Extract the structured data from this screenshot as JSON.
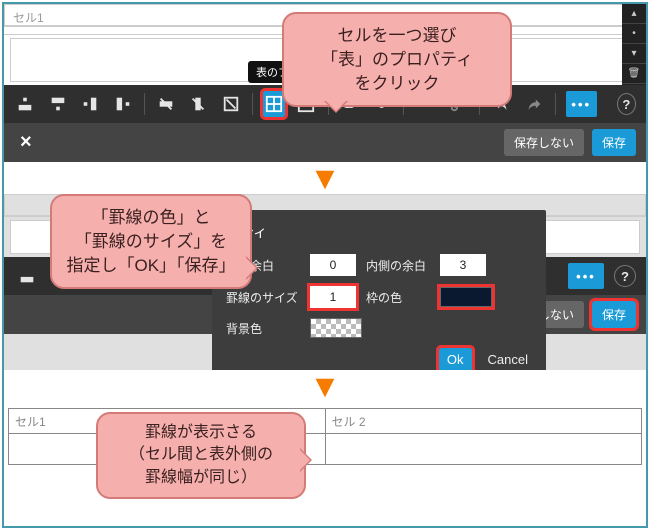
{
  "section1": {
    "cell1_label": "セル1",
    "tooltip": "表のプロパティ",
    "footer": {
      "cancel": "保存しない",
      "save": "保存"
    }
  },
  "callouts": {
    "c1_l1": "セルを一つ選び",
    "c1_l2": "「表」のプロパティ",
    "c1_l3": "をクリック",
    "c2_l1": "「罫線の色」と",
    "c2_l2": "「罫線のサイズ」を",
    "c2_l3": "指定し「OK」「保存」",
    "c3_l1": "罫線が表示さる",
    "c3_l2": "（セル間と表外側の",
    "c3_l3": "罫線幅が同じ）"
  },
  "dialog": {
    "title_suffix": "パティ",
    "outer_margin_label": "側の余白",
    "outer_margin_value": "0",
    "inner_margin_label": "内側の余白",
    "inner_margin_value": "3",
    "border_size_label": "罫線のサイズ",
    "border_size_value": "1",
    "border_color_label": "枠の色",
    "bg_label": "背景色",
    "ok": "Ok",
    "cancel": "Cancel"
  },
  "section2_footer": {
    "cancel": "保存しない",
    "save": "保存"
  },
  "result": {
    "cell1": "セル1",
    "cell2": "セル 2"
  },
  "arrow_glyph": "▼"
}
